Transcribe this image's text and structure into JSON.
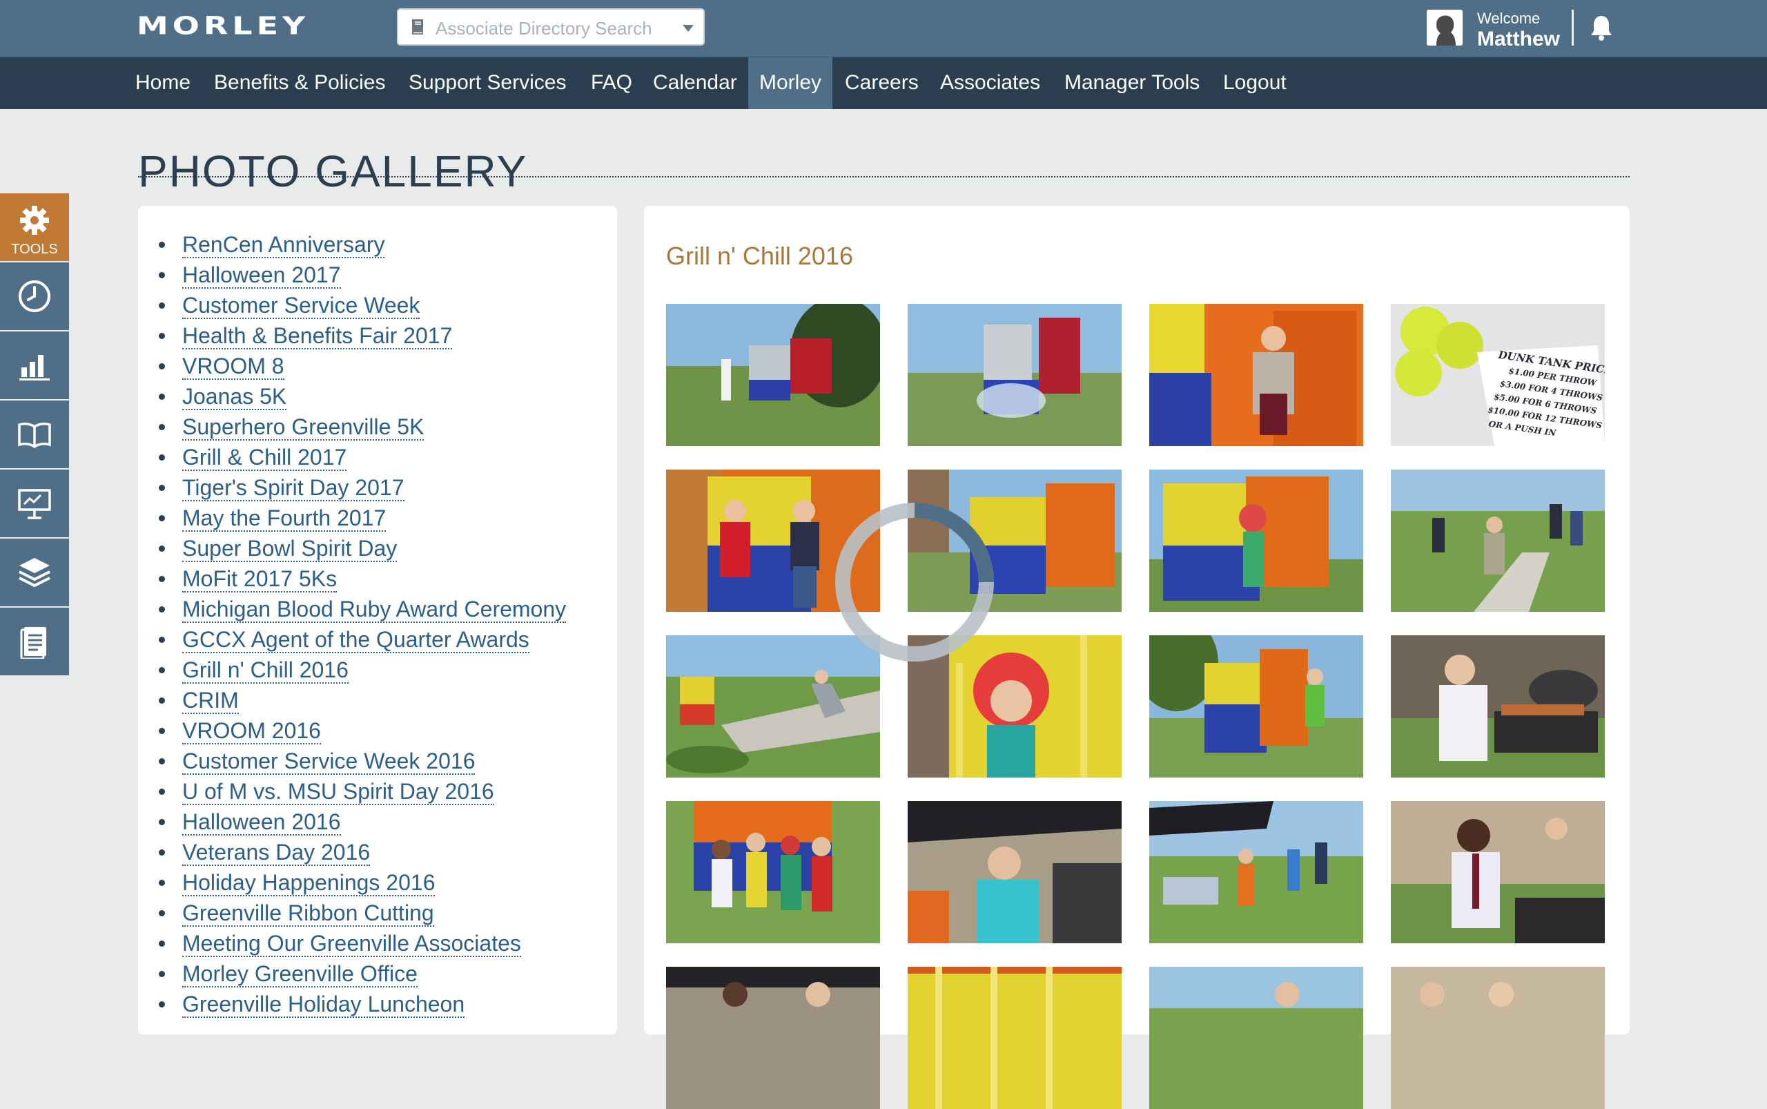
{
  "header": {
    "logo": "MORLEY",
    "search_placeholder": "Associate Directory Search",
    "welcome_label": "Welcome",
    "user_name": "Matthew"
  },
  "nav": [
    "Home",
    "Benefits & Policies",
    "Support Services",
    "FAQ",
    "Calendar",
    "Morley",
    "Careers",
    "Associates",
    "Manager Tools",
    "Logout"
  ],
  "nav_active": "Morley",
  "page_title": "PHOTO GALLERY",
  "tools_label": "TOOLS",
  "side_tools": [
    "gear-icon",
    "clock-icon",
    "bar-chart-icon",
    "book-icon",
    "presentation-icon",
    "layers-icon",
    "document-icon"
  ],
  "albums": [
    "RenCen Anniversary",
    "Halloween 2017",
    "Customer Service Week",
    "Health & Benefits Fair 2017",
    "VROOM 8",
    "Joanas 5K",
    "Superhero Greenville 5K",
    "Grill & Chill 2017",
    "Tiger's Spirit Day 2017",
    "May the Fourth 2017",
    "Super Bowl Spirit Day",
    "MoFit 2017 5Ks",
    "Michigan Blood Ruby Award Ceremony",
    "GCCX Agent of the Quarter Awards",
    "Grill n' Chill 2016",
    "CRIM",
    "VROOM 2016",
    "Customer Service Week 2016",
    "U of M vs. MSU Spirit Day 2016",
    "Halloween 2016",
    "Veterans Day 2016",
    "Holiday Happenings 2016",
    "Greenville Ribbon Cutting",
    "Meeting Our Greenville Associates",
    "Morley Greenville Office",
    "Greenville Holiday Luncheon"
  ],
  "selected_album": "Grill n' Chill 2016",
  "sign_text": [
    "DUNK TANK PRICES",
    "$1.00 PER THROW",
    "$3.00 FOR 4 THROWS",
    "$5.00 FOR 6 THROWS",
    "$10.00 FOR 12 THROWS",
    "OR A PUSH IN"
  ],
  "colors": {
    "header": "#4f6f89",
    "nav": "#2c3f50",
    "accent": "#c07a35",
    "link": "#2c5e8a",
    "album_title": "#a8773a"
  }
}
